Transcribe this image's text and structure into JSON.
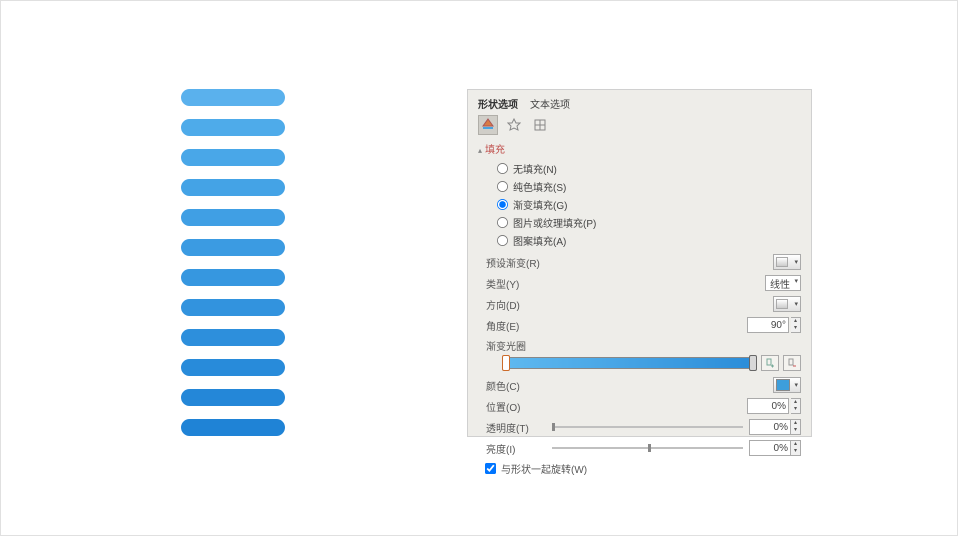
{
  "shapes": {
    "count": 12,
    "colors": [
      "#5ab1ed",
      "#4eabea",
      "#49a7e8",
      "#44a3e6",
      "#409fe4",
      "#3b9be2",
      "#3697e0",
      "#3293de",
      "#2d8fdc",
      "#288bda",
      "#2487d8",
      "#1f83d6"
    ]
  },
  "panel": {
    "tabs": {
      "shape_options": "形状选项",
      "text_options": "文本选项"
    },
    "section_fill": "填充",
    "fill_options": {
      "no_fill": "无填充(N)",
      "solid": "纯色填充(S)",
      "gradient": "渐变填充(G)",
      "picture": "图片或纹理填充(P)",
      "pattern": "图案填充(A)"
    },
    "preset_gradient": "预设渐变(R)",
    "type_label": "类型(Y)",
    "type_value": "线性",
    "direction": "方向(D)",
    "angle": "角度(E)",
    "angle_value": "90°",
    "gradient_stops": "渐变光圈",
    "color_label": "颜色(C)",
    "position": "位置(O)",
    "position_value": "0%",
    "transparency": "透明度(T)",
    "transparency_value": "0%",
    "brightness": "亮度(I)",
    "brightness_value": "0%",
    "rotate_with_shape": "与形状一起旋转(W)"
  }
}
